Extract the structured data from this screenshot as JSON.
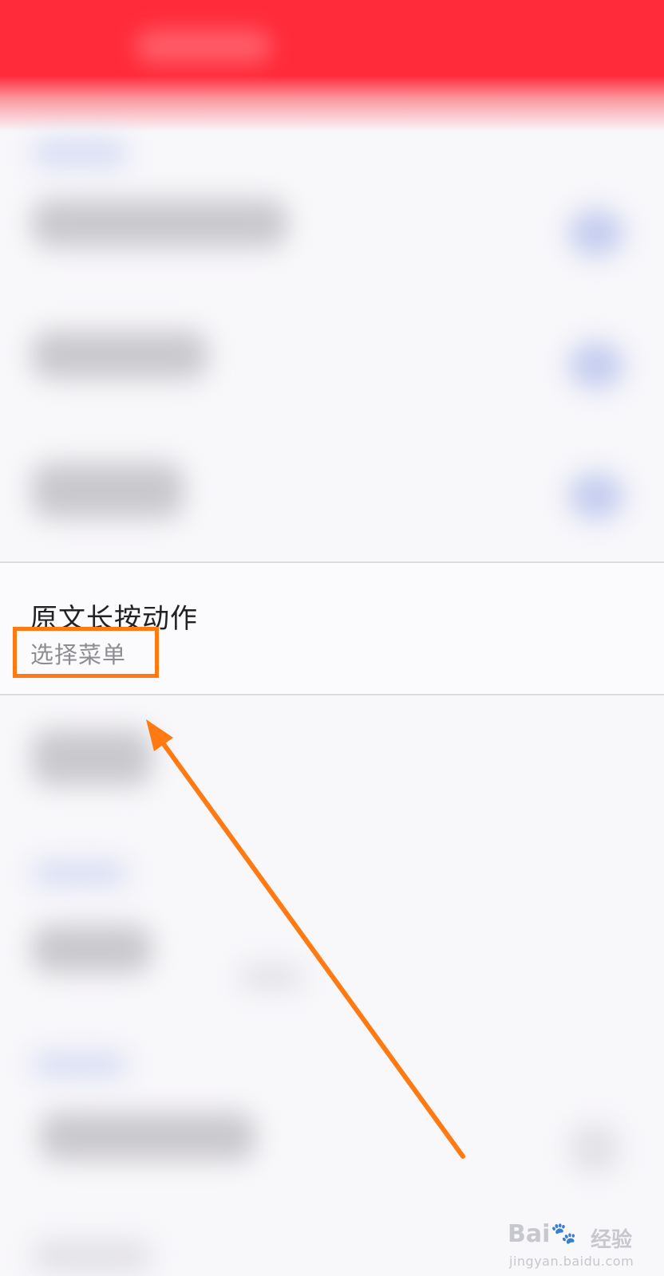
{
  "setting": {
    "title": "原文长按动作",
    "value": "选择菜单"
  },
  "watermark": {
    "brand": "Bai",
    "paw": "🐾",
    "brand_cn": "经验",
    "url": "jingyan.baidu.com"
  },
  "colors": {
    "header_red": "#ff2b3a",
    "annotation_orange": "#ff7a12",
    "background": "#f8f7fa"
  }
}
